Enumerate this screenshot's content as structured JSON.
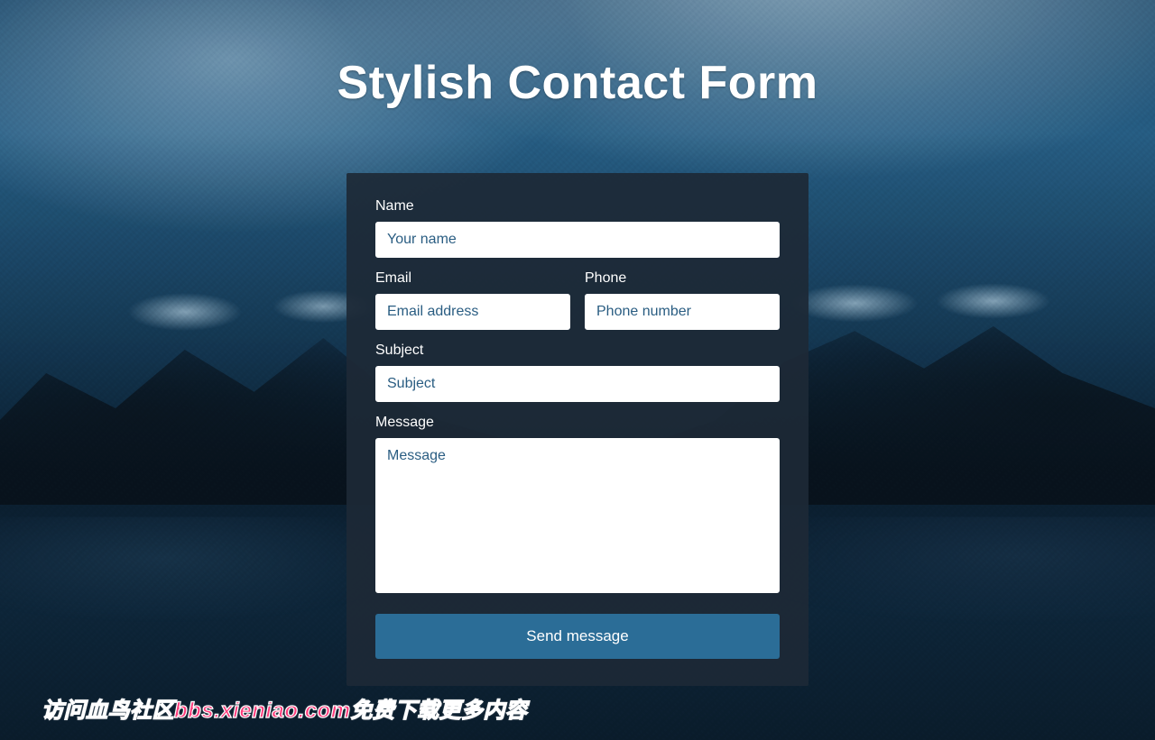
{
  "title": "Stylish Contact Form",
  "form": {
    "name": {
      "label": "Name",
      "placeholder": "Your name",
      "value": ""
    },
    "email": {
      "label": "Email",
      "placeholder": "Email address",
      "value": ""
    },
    "phone": {
      "label": "Phone",
      "placeholder": "Phone number",
      "value": ""
    },
    "subject": {
      "label": "Subject",
      "placeholder": "Subject",
      "value": ""
    },
    "message": {
      "label": "Message",
      "placeholder": "Message",
      "value": ""
    },
    "submit_label": "Send message"
  },
  "watermark": "访问血鸟社区bbs.xieniao.com免费下载更多内容"
}
